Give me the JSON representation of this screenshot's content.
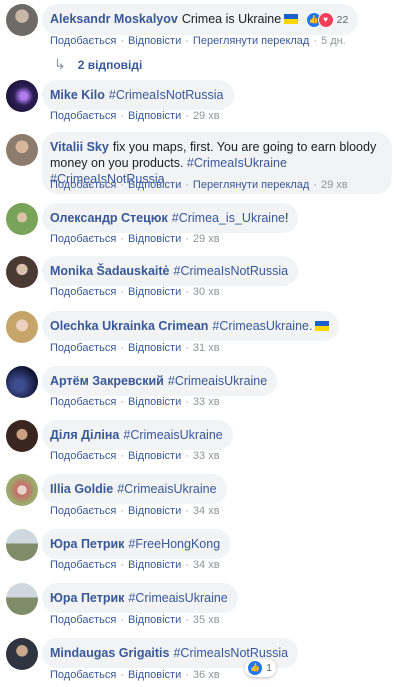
{
  "reactions_top": {
    "count": "22"
  },
  "replies_link": "2 відповіді",
  "like_label": "Подобається",
  "reply_label": "Відповісти",
  "translate_label": "Переглянути переклад",
  "comments": [
    {
      "author": "Aleksandr Moskalyov",
      "text": "Crimea is Ukraine",
      "time": "5 дн."
    },
    {
      "author": "Mike Kilo",
      "text": "#CrimeaIsNotRussia",
      "time": "29 хв"
    },
    {
      "author": "Vitalii Sky",
      "text1": "fix you maps, first. You are going to earn bloody",
      "text2": "money on you products.",
      "tag1": "#CrimeaIsUkraine",
      "tag2": "#CrimeaIsNotRussia",
      "time": "29 хв"
    },
    {
      "author": "Олександр Стецюк",
      "text": "#Crimea_is_Ukraine",
      "suffix": "!",
      "time": "29 хв"
    },
    {
      "author": "Monika Šadauskaitė",
      "text": "#CrimeaIsNotRussia",
      "time": "30 хв"
    },
    {
      "author": "Olechka Ukrainka Crimean",
      "text": "#CrimeasUkraine.",
      "time": "31 хв"
    },
    {
      "author": "Артём Закревский",
      "text": "#CrimeaisUkraine",
      "time": "33 хв"
    },
    {
      "author": "Діля Діліна",
      "text": "#CrimeaisUkraine",
      "time": "33 хв"
    },
    {
      "author": "Illia Goldie",
      "text": "#CrimeaisUkraine",
      "time": "34 хв"
    },
    {
      "author": "Юра Петрик",
      "text": "#FreeHongKong",
      "time": "34 хв"
    },
    {
      "author": "Юра Петрик",
      "text": "#CrimeaisUkraine",
      "time": "35 хв"
    },
    {
      "author": "Mindaugas Grigaitis",
      "text": "#CrimeaIsNotRussia",
      "time": "36 хв",
      "reactions": "1"
    }
  ]
}
